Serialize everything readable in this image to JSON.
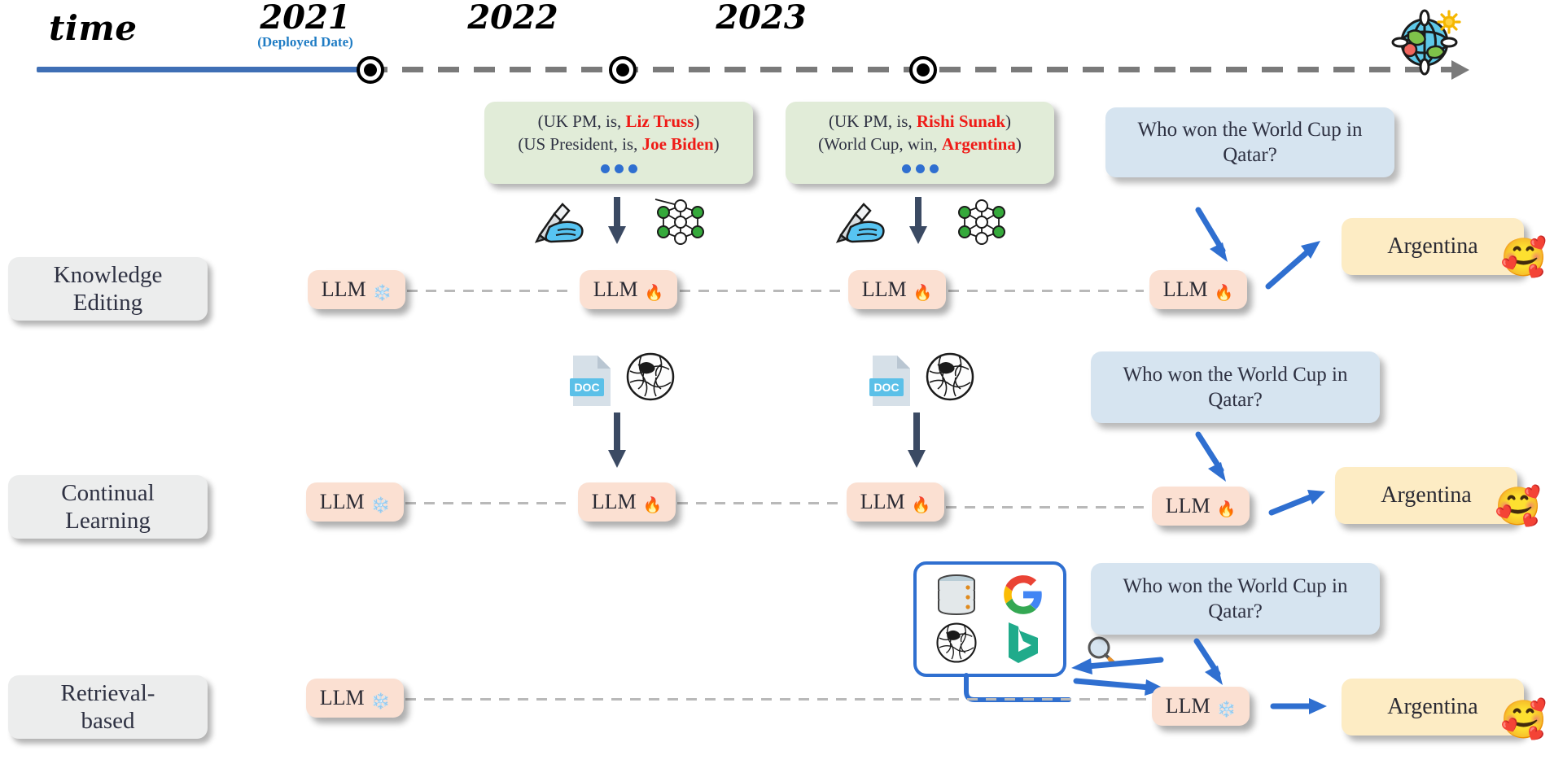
{
  "timeline": {
    "axis_label": "time",
    "deployed_note": "(Deployed Date)",
    "world_icon": "globe-icon",
    "ticks": [
      {
        "year": "2021"
      },
      {
        "year": "2022"
      },
      {
        "year": "2023"
      }
    ]
  },
  "facts": [
    {
      "year": "2022",
      "lines": [
        {
          "prefix": "(UK PM, is, ",
          "highlight": "Liz Truss",
          "suffix": ")"
        },
        {
          "prefix": "(US President, is, ",
          "highlight": "Joe Biden",
          "suffix": ")"
        }
      ],
      "ellipsis": "•••"
    },
    {
      "year": "2023",
      "lines": [
        {
          "prefix": "(UK PM, is, ",
          "highlight": "Rishi Sunak",
          "suffix": ")"
        },
        {
          "prefix": "(World Cup, win, ",
          "highlight": "Argentina",
          "suffix": ")"
        }
      ],
      "ellipsis": "•••"
    }
  ],
  "rows": [
    {
      "label_line1": "Knowledge",
      "label_line2": "Editing",
      "question": "Who won the World Cup in Qatar?",
      "answer": "Argentina",
      "answer_emoji": "smiling-face-with-hearts",
      "update_icons": [
        "writing-hand-icon",
        "down-arrow-icon",
        "neural-network-icon"
      ],
      "llms": [
        {
          "label": "LLM",
          "state": "frozen",
          "state_icon": "snowflake-icon"
        },
        {
          "label": "LLM",
          "state": "trainable",
          "state_icon": "flame-icon"
        },
        {
          "label": "LLM",
          "state": "trainable",
          "state_icon": "flame-icon"
        },
        {
          "label": "LLM",
          "state": "trainable",
          "state_icon": "flame-icon"
        }
      ]
    },
    {
      "label_line1": "Continual",
      "label_line2": "Learning",
      "question": "Who won the World Cup in Qatar?",
      "answer": "Argentina",
      "answer_emoji": "smiling-face-with-hearts",
      "update_icons": [
        "doc-file-icon",
        "wikipedia-icon",
        "down-arrow-icon"
      ],
      "doc_label": "DOC",
      "llms": [
        {
          "label": "LLM",
          "state": "frozen",
          "state_icon": "snowflake-icon"
        },
        {
          "label": "LLM",
          "state": "trainable",
          "state_icon": "flame-icon"
        },
        {
          "label": "LLM",
          "state": "trainable",
          "state_icon": "flame-icon"
        },
        {
          "label": "LLM",
          "state": "trainable",
          "state_icon": "flame-icon"
        }
      ]
    },
    {
      "label_line1": "Retrieval-",
      "label_line2": "based",
      "question": "Who won the World Cup in Qatar?",
      "answer": "Argentina",
      "answer_emoji": "smiling-face-with-hearts",
      "sources": [
        "database-icon",
        "google-icon",
        "wikipedia-icon",
        "bing-icon"
      ],
      "search_icon": "magnifying-glass-icon",
      "llms": [
        {
          "label": "LLM",
          "state": "frozen",
          "state_icon": "snowflake-icon"
        },
        {
          "label": "LLM",
          "state": "frozen",
          "state_icon": "snowflake-icon"
        }
      ]
    }
  ],
  "colors": {
    "axis_blue": "#3f6fb5",
    "axis_gray": "#7a7a7a",
    "fact_green": "#e1ecd8",
    "highlight_red": "#ef1b17",
    "llm_peach": "#fbe0d2",
    "question_blue": "#d6e4f0",
    "answer_cream": "#fdecc4",
    "label_gray": "#eceded",
    "arrow_blue": "#2f6fd0",
    "deployed_blue": "#1f7cc4"
  }
}
